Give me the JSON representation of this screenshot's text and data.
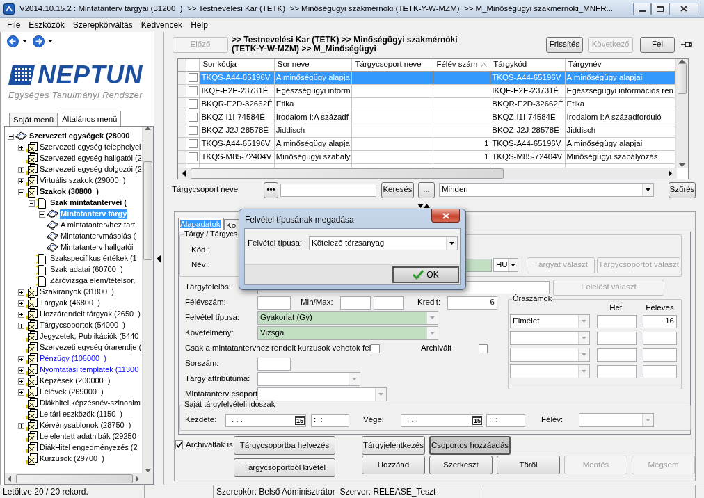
{
  "window": {
    "title": "V2014.10.15.2 : Mintatanterv tárgyai (31200  )  >> Testnevelési Kar (TETK)  >> Minőségügyi szakmérnöki (TETK-Y-W-MZM)  >> M_Minőségügyi szakmérnöki_MNFR..."
  },
  "menu": [
    "File",
    "Eszközök",
    "Szerepkörváltás",
    "Kedvencek",
    "Help"
  ],
  "logo": {
    "title": "NEPTUN",
    "subtitle": "Egységes Tanulmányi Rendszer"
  },
  "menu_tabs": [
    {
      "label": "Saját menü",
      "selected": false
    },
    {
      "label": "Általános menü",
      "selected": true
    }
  ],
  "tree": [
    {
      "label": "Szervezeti egységek (28000",
      "kind": "book",
      "expanded": true,
      "selected": false,
      "link": false,
      "children": [
        {
          "label": "Szervezeti egység telephelyei",
          "kind": "docs",
          "expanded": false,
          "selected": false,
          "link": false
        },
        {
          "label": "Szervezeti egység hallgatói (2",
          "kind": "docs",
          "selected": false,
          "link": false
        },
        {
          "label": "Szervezeti egység dolgozói (2",
          "kind": "docs",
          "expanded": false,
          "selected": false,
          "link": false
        },
        {
          "label": "Virtuális szakok (29000  )",
          "kind": "docs",
          "expanded": false,
          "selected": false,
          "link": false
        },
        {
          "label": "Szakok (30800  )",
          "kind": "docs",
          "expanded": true,
          "selected": false,
          "link": false,
          "children": [
            {
              "label": "Szak mintatantervei (",
              "kind": "page",
              "expanded": true,
              "selected": false,
              "link": false,
              "children": [
                {
                  "label": "Mintatanterv tárgy",
                  "kind": "book",
                  "expanded": false,
                  "selected": true
                },
                {
                  "label": "A mintatantervhez tart",
                  "kind": "book",
                  "selected": false,
                  "link": false
                },
                {
                  "label": "Mintatantervmásolás (",
                  "kind": "book",
                  "selected": false,
                  "link": false
                },
                {
                  "label": "Mintatanterv hallgatói",
                  "kind": "book",
                  "selected": false,
                  "link": false
                }
              ]
            },
            {
              "label": "Szakspecifikus értékek (1",
              "kind": "page",
              "selected": false,
              "link": false
            },
            {
              "label": "Szak adatai (60700  )",
              "kind": "page",
              "selected": false,
              "link": false
            },
            {
              "label": "Záróvizsga elem/tételsor,",
              "kind": "page",
              "selected": false,
              "link": false
            }
          ]
        },
        {
          "label": "Szakirányok (31800  )",
          "kind": "docs",
          "expanded": false,
          "selected": false,
          "link": false
        },
        {
          "label": "Tárgyak (46800  )",
          "kind": "docs",
          "expanded": false,
          "selected": false,
          "link": false
        },
        {
          "label": "Hozzárendelt tárgyak (2650  )",
          "kind": "docs",
          "expanded": false,
          "selected": false,
          "link": false
        },
        {
          "label": "Tárgycsoportok (54000  )",
          "kind": "docs",
          "expanded": false,
          "selected": false,
          "link": false
        },
        {
          "label": "Jegyzetek, Publikációk (5440",
          "kind": "docs",
          "selected": false,
          "link": false
        },
        {
          "label": "Szervezeti egység órarendje (",
          "kind": "docs",
          "selected": false,
          "link": false
        },
        {
          "label": "Pénzügy (106000  )",
          "kind": "docs",
          "expanded": false,
          "selected": false,
          "link": true
        },
        {
          "label": "Nyomtatási templatek (11300",
          "kind": "docs",
          "expanded": false,
          "selected": false,
          "link": true
        },
        {
          "label": "Képzések (200000  )",
          "kind": "docs",
          "expanded": false,
          "selected": false,
          "link": false
        },
        {
          "label": "Félévek (269000  )",
          "kind": "docs",
          "expanded": false,
          "selected": false,
          "link": false
        },
        {
          "label": "Diákhitel képzésnév-szinonim",
          "kind": "docs",
          "selected": false,
          "link": false
        },
        {
          "label": "Leltári eszközök (1150  )",
          "kind": "docs",
          "selected": false,
          "link": false
        },
        {
          "label": "Kérvénysablonok (28750  )",
          "kind": "docs",
          "expanded": false,
          "selected": false,
          "link": false
        },
        {
          "label": "Lejelentett adathibák (29250",
          "kind": "docs",
          "selected": false,
          "link": false
        },
        {
          "label": "DiákHitel engedményezés (2",
          "kind": "docs",
          "selected": false,
          "link": false
        },
        {
          "label": "Kurzusok (29700  )",
          "kind": "docs",
          "selected": false,
          "link": false
        }
      ]
    }
  ],
  "toolbar": {
    "back_button": {
      "label": "Előző",
      "disabled": true
    },
    "breadcrumb": ">> Testnevelési Kar (TETK) >> Minőségügyi szakmérnöki (TETK-Y-W-MZM) >> M_Minőségügyi",
    "buttons": [
      {
        "label": "Frissítés",
        "disabled": false
      },
      {
        "label": "Következő",
        "disabled": true
      },
      {
        "label": "Fel",
        "disabled": false
      }
    ]
  },
  "grid": {
    "columns": [
      {
        "label": "Sor kódja",
        "sorted": false
      },
      {
        "label": "Sor neve",
        "sorted": false
      },
      {
        "label": "Tárgycsoport neve",
        "sorted": false
      },
      {
        "label": "Félév szám",
        "sorted": true
      },
      {
        "label": "Tárgykód",
        "sorted": false
      },
      {
        "label": "Tárgynév",
        "sorted": false
      }
    ],
    "rows": [
      {
        "selected": true,
        "checked": false,
        "cells": [
          "TKQS-A44-65196V",
          "A minőségügy alapja",
          "",
          "",
          "TKQS-A44-65196V",
          "A minőségügy alapjai"
        ]
      },
      {
        "selected": false,
        "checked": false,
        "cells": [
          "IKQF-E2E-23731É",
          "Egészségügyi inform",
          "",
          "",
          "IKQF-E2E-23731É",
          "Egészségügyi információs ren"
        ]
      },
      {
        "selected": false,
        "checked": false,
        "cells": [
          "BKQR-E2D-32662É",
          "Etika",
          "",
          "",
          "BKQR-E2D-32662É",
          "Etika"
        ]
      },
      {
        "selected": false,
        "checked": false,
        "cells": [
          "BKQZ-I1I-74584É",
          "Irodalom I:A századf",
          "",
          "",
          "BKQZ-I1I-74584É",
          "Irodalom I:A századforduló"
        ]
      },
      {
        "selected": false,
        "checked": false,
        "cells": [
          "BKQZ-J2J-28578É",
          "Jiddisch",
          "",
          "",
          "BKQZ-J2J-28578É",
          "Jiddisch"
        ]
      },
      {
        "selected": false,
        "checked": false,
        "cells": [
          "TKQS-A44-65196V",
          "A minőségügy alapja",
          "",
          "1",
          "TKQS-A44-65196V",
          "A minőségügy alapjai"
        ]
      },
      {
        "selected": false,
        "checked": false,
        "cells": [
          "TKQS-M85-72404V",
          "Minőségügyi szabály",
          "",
          "1",
          "TKQS-M85-72404V",
          "Minőségügyi szabályozás"
        ]
      }
    ]
  },
  "filter": {
    "label": "Tárgycsoport neve",
    "options_button": "•••",
    "search_button": "Keresés",
    "more_button": "...",
    "scope": "Minden",
    "filter_button": "Szűrés"
  },
  "detail": {
    "tabs": [
      {
        "label": "Alapadatok",
        "selected": true
      },
      {
        "label": "Kö",
        "selected": false
      }
    ],
    "subject_group": {
      "legend": "Tárgy / Tárgycs",
      "code_label": "Kód :",
      "name_label": "Név :",
      "language": "HU",
      "buttons": [
        {
          "label": "Tárgyat választ",
          "disabled": true
        },
        {
          "label": "Tárgycsoportot választ",
          "disabled": true
        }
      ]
    },
    "responsible": {
      "label": "Tárgyfelelős:",
      "button": {
        "label": "Felelőst választ",
        "disabled": true
      }
    },
    "semester": {
      "label": "Félévszám:",
      "minmax_label": "Min/Max:",
      "credit_label": "Kredit:",
      "credit": "6"
    },
    "selects": [
      {
        "label": "Felvétel típusa:",
        "value": "Gyakorlat (Gy)",
        "disabled": true
      },
      {
        "label": "Követelmény:",
        "value": "Vizsga",
        "disabled": true
      }
    ],
    "checks": [
      {
        "label": "Csak a mintatantervhez rendelt kurzusok vehetok fel",
        "checked": false
      },
      {
        "label": "Archivált",
        "checked": false
      }
    ],
    "order_label": "Sorszám:",
    "attribute": {
      "label": "Tárgy attribútuma:",
      "disabled": true
    },
    "group": {
      "label": "Mintatanterv csoport",
      "disabled": true
    },
    "hours": {
      "legend": "Óraszámok",
      "columns": [
        "Heti",
        "Féleves"
      ],
      "rows": [
        {
          "type": "Elmélet",
          "per_semester": "16",
          "disabled": true
        },
        {
          "disabled": true
        },
        {
          "disabled": true
        },
        {
          "disabled": true
        }
      ]
    },
    "period": {
      "legend": "Saját tárgyfelvételi idoszak",
      "start_label": "Kezdete:",
      "start_date": ". . .",
      "start_calendar": "15",
      "start_time": ":  :",
      "end_label": "Vége:",
      "end_date": ". . .",
      "end_calendar": "15",
      "end_time": ":  :",
      "semester_label": "Félév:",
      "semester_disabled": true
    }
  },
  "archived_filter": {
    "label": "Archiváltak is",
    "checked": true
  },
  "group_buttons": [
    "Tárgycsoportba helyezés",
    "Tárgycsoportból kivétel"
  ],
  "action_rows": [
    [
      {
        "label": "Tárgyjelentkezés",
        "disabled": false,
        "pressed": false
      },
      {
        "label": "Csoportos hozzáadás",
        "disabled": false,
        "pressed": true
      }
    ],
    [
      {
        "label": "Hozzáad",
        "disabled": false,
        "pressed": false
      },
      {
        "label": "Szerkeszt",
        "disabled": false,
        "pressed": false
      },
      {
        "label": "Töröl",
        "disabled": false,
        "pressed": false
      },
      {
        "label": "Mentés",
        "disabled": true,
        "pressed": false
      },
      {
        "label": "Mégsem",
        "disabled": true,
        "pressed": false
      }
    ]
  ],
  "dialog": {
    "title": "Felvétel típusának megadása",
    "label": "Felvétel típusa:",
    "value": "Kötelező törzsanyag",
    "ok_button": "OK"
  },
  "status_bar": [
    "Letöltve 20 / 20 rekord.",
    "Szerepkör: Belső Adminisztrátor  Szerver: RELEASE_Teszt"
  ]
}
